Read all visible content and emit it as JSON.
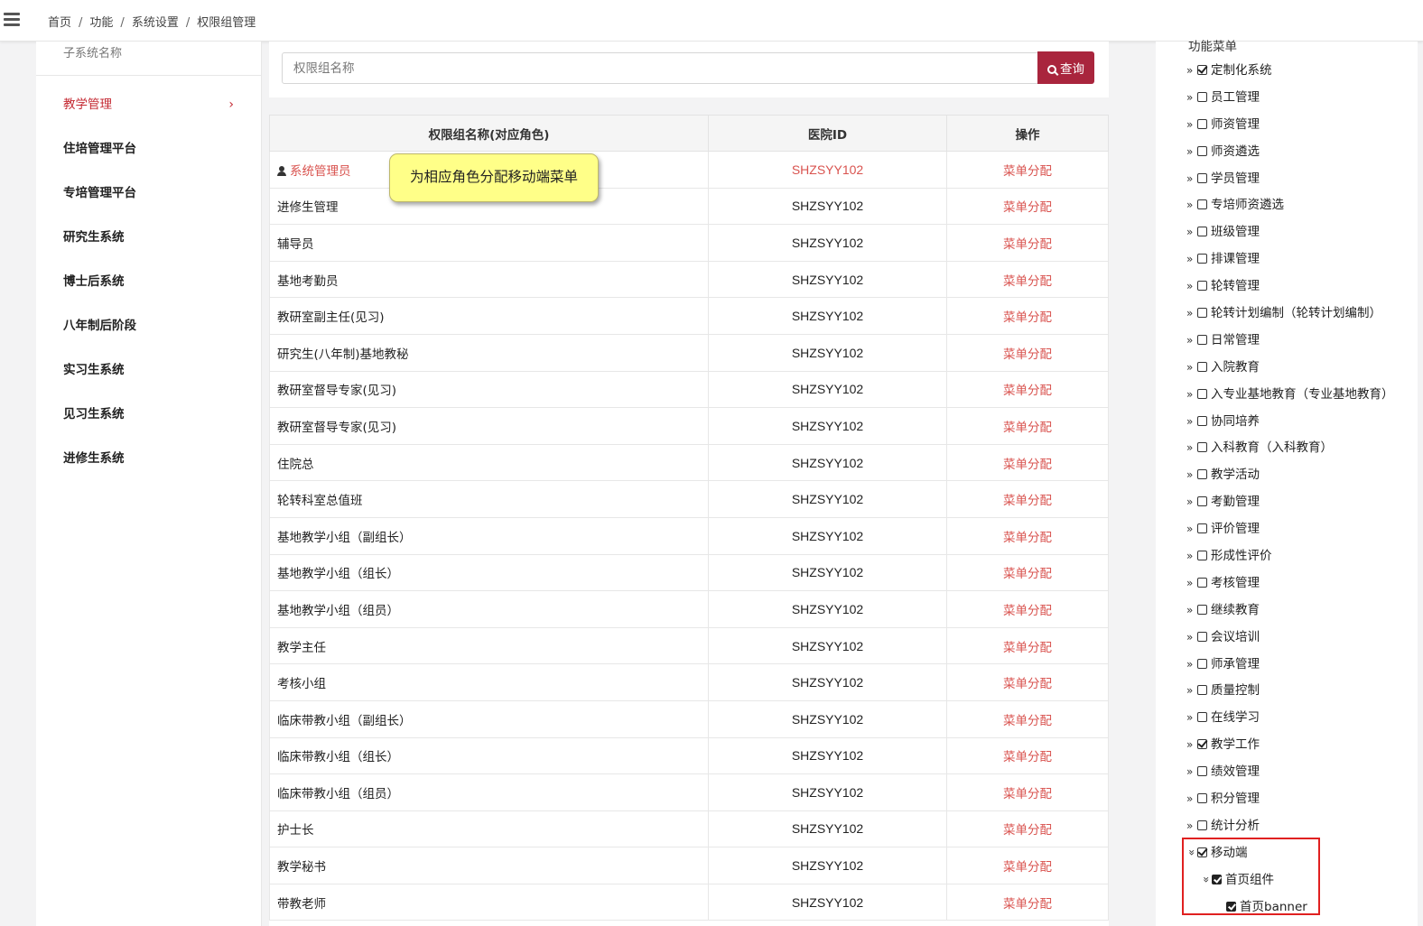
{
  "breadcrumb": [
    "首页",
    "功能",
    "系统设置",
    "权限组管理"
  ],
  "left_panel": {
    "header": "子系统名称",
    "items": [
      {
        "label": "教学管理",
        "active": true
      },
      {
        "label": "住培管理平台"
      },
      {
        "label": "专培管理平台"
      },
      {
        "label": "研究生系统"
      },
      {
        "label": "博士后系统"
      },
      {
        "label": "八年制后阶段"
      },
      {
        "label": "实习生系统"
      },
      {
        "label": "见习生系统"
      },
      {
        "label": "进修生系统"
      }
    ]
  },
  "search": {
    "placeholder": "权限组名称",
    "button_label": "查询"
  },
  "table": {
    "headers": [
      "权限组名称(对应角色)",
      "医院ID",
      "操作"
    ],
    "rows": [
      {
        "name": "系统管理员",
        "hospital_id": "SHZSYY102",
        "action": "菜单分配",
        "highlight": true
      },
      {
        "name": "进修生管理",
        "hospital_id": "SHZSYY102",
        "action": "菜单分配"
      },
      {
        "name": "辅导员",
        "hospital_id": "SHZSYY102",
        "action": "菜单分配"
      },
      {
        "name": "基地考勤员",
        "hospital_id": "SHZSYY102",
        "action": "菜单分配"
      },
      {
        "name": "教研室副主任(见习)",
        "hospital_id": "SHZSYY102",
        "action": "菜单分配"
      },
      {
        "name": "研究生(八年制)基地教秘",
        "hospital_id": "SHZSYY102",
        "action": "菜单分配"
      },
      {
        "name": "教研室督导专家(见习)",
        "hospital_id": "SHZSYY102",
        "action": "菜单分配"
      },
      {
        "name": "教研室督导专家(见习)",
        "hospital_id": "SHZSYY102",
        "action": "菜单分配"
      },
      {
        "name": "住院总",
        "hospital_id": "SHZSYY102",
        "action": "菜单分配"
      },
      {
        "name": "轮转科室总值班",
        "hospital_id": "SHZSYY102",
        "action": "菜单分配"
      },
      {
        "name": "基地教学小组（副组长）",
        "hospital_id": "SHZSYY102",
        "action": "菜单分配"
      },
      {
        "name": "基地教学小组（组长）",
        "hospital_id": "SHZSYY102",
        "action": "菜单分配"
      },
      {
        "name": "基地教学小组（组员）",
        "hospital_id": "SHZSYY102",
        "action": "菜单分配"
      },
      {
        "name": "教学主任",
        "hospital_id": "SHZSYY102",
        "action": "菜单分配"
      },
      {
        "name": "考核小组",
        "hospital_id": "SHZSYY102",
        "action": "菜单分配"
      },
      {
        "name": "临床带教小组（副组长）",
        "hospital_id": "SHZSYY102",
        "action": "菜单分配"
      },
      {
        "name": "临床带教小组（组长）",
        "hospital_id": "SHZSYY102",
        "action": "菜单分配"
      },
      {
        "name": "临床带教小组（组员）",
        "hospital_id": "SHZSYY102",
        "action": "菜单分配"
      },
      {
        "name": "护士长",
        "hospital_id": "SHZSYY102",
        "action": "菜单分配"
      },
      {
        "name": "教学秘书",
        "hospital_id": "SHZSYY102",
        "action": "菜单分配"
      },
      {
        "name": "带教老师",
        "hospital_id": "SHZSYY102",
        "action": "菜单分配"
      }
    ]
  },
  "tooltip": "为相应角色分配移动端菜单",
  "menu_tree": {
    "header": "功能菜单",
    "items": [
      {
        "label": "定制化系统",
        "checked": true,
        "level": 0,
        "arrow": "»"
      },
      {
        "label": "员工管理",
        "checked": false,
        "level": 0,
        "arrow": "»"
      },
      {
        "label": "师资管理",
        "checked": false,
        "level": 0,
        "arrow": "»"
      },
      {
        "label": "师资遴选",
        "checked": false,
        "level": 0,
        "arrow": "»"
      },
      {
        "label": "学员管理",
        "checked": false,
        "level": 0,
        "arrow": "»"
      },
      {
        "label": "专培师资遴选",
        "checked": false,
        "level": 0,
        "arrow": "»"
      },
      {
        "label": "班级管理",
        "checked": false,
        "level": 0,
        "arrow": "»"
      },
      {
        "label": "排课管理",
        "checked": false,
        "level": 0,
        "arrow": "»"
      },
      {
        "label": "轮转管理",
        "checked": false,
        "level": 0,
        "arrow": "»"
      },
      {
        "label": "轮转计划编制（轮转计划编制）",
        "checked": false,
        "level": 0,
        "arrow": "»"
      },
      {
        "label": "日常管理",
        "checked": false,
        "level": 0,
        "arrow": "»"
      },
      {
        "label": "入院教育",
        "checked": false,
        "level": 0,
        "arrow": "»"
      },
      {
        "label": "入专业基地教育（专业基地教育）",
        "checked": false,
        "level": 0,
        "arrow": "»"
      },
      {
        "label": "协同培养",
        "checked": false,
        "level": 0,
        "arrow": "»"
      },
      {
        "label": "入科教育（入科教育）",
        "checked": false,
        "level": 0,
        "arrow": "»"
      },
      {
        "label": "教学活动",
        "checked": false,
        "level": 0,
        "arrow": "»"
      },
      {
        "label": "考勤管理",
        "checked": false,
        "level": 0,
        "arrow": "»"
      },
      {
        "label": "评价管理",
        "checked": false,
        "level": 0,
        "arrow": "»"
      },
      {
        "label": "形成性评价",
        "checked": false,
        "level": 0,
        "arrow": "»"
      },
      {
        "label": "考核管理",
        "checked": false,
        "level": 0,
        "arrow": "»"
      },
      {
        "label": "继续教育",
        "checked": false,
        "level": 0,
        "arrow": "»"
      },
      {
        "label": "会议培训",
        "checked": false,
        "level": 0,
        "arrow": "»"
      },
      {
        "label": "师承管理",
        "checked": false,
        "level": 0,
        "arrow": "»"
      },
      {
        "label": "质量控制",
        "checked": false,
        "level": 0,
        "arrow": "»"
      },
      {
        "label": "在线学习",
        "checked": false,
        "level": 0,
        "arrow": "»"
      },
      {
        "label": "教学工作",
        "checked": true,
        "level": 0,
        "arrow": "»"
      },
      {
        "label": "绩效管理",
        "checked": false,
        "level": 0,
        "arrow": "»"
      },
      {
        "label": "积分管理",
        "checked": false,
        "level": 0,
        "arrow": "»"
      },
      {
        "label": "统计分析",
        "checked": false,
        "level": 0,
        "arrow": "»"
      },
      {
        "label": "移动端",
        "checked": true,
        "level": 0,
        "arrow": "»",
        "expanded": true
      },
      {
        "label": "首页组件",
        "checked": true,
        "filled": true,
        "level": 1,
        "arrow": "»",
        "expanded": true
      },
      {
        "label": "首页banner",
        "checked": true,
        "filled": true,
        "level": 2,
        "arrow": ""
      }
    ]
  }
}
